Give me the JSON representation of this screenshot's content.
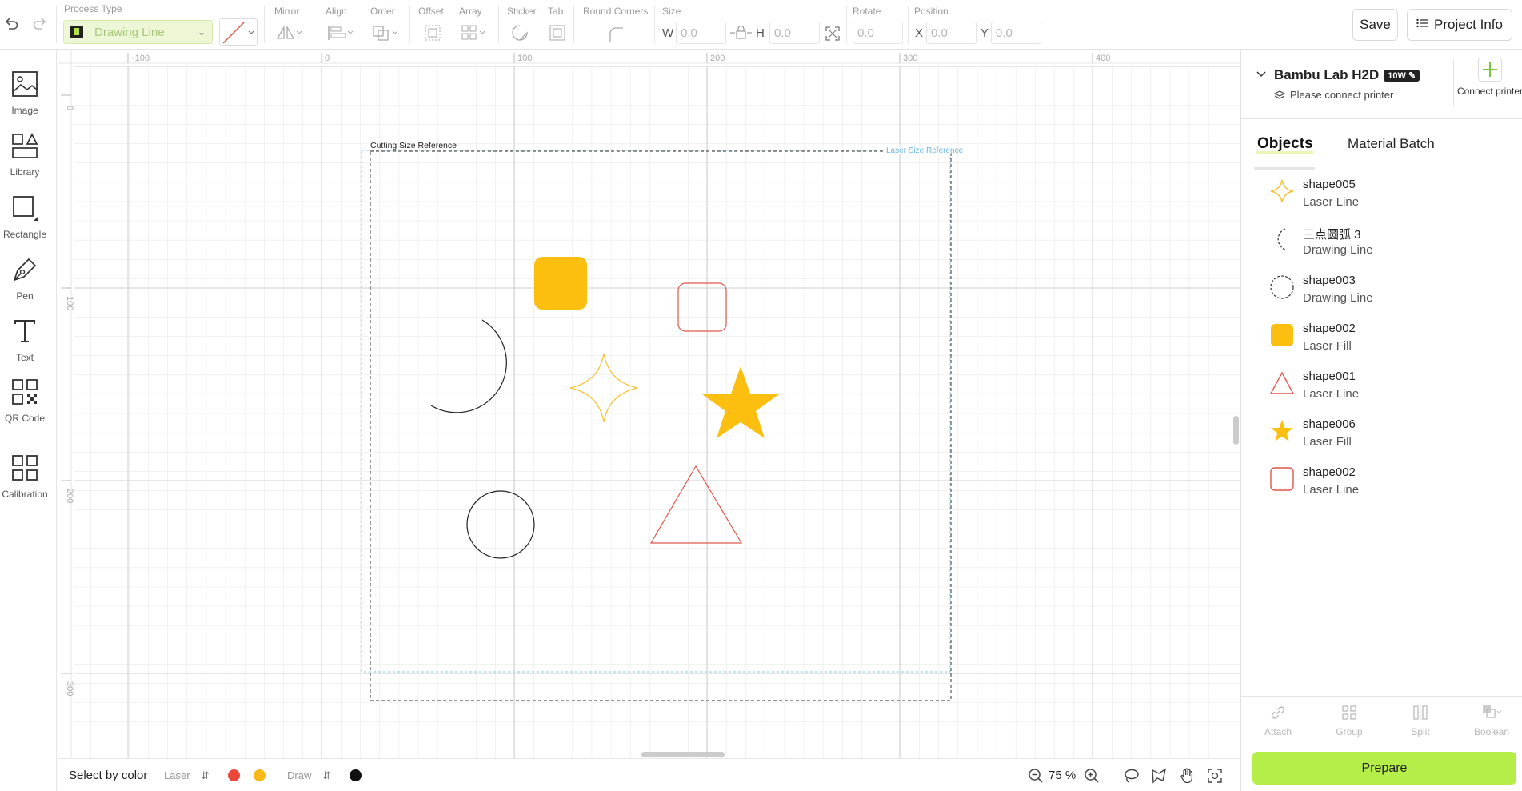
{
  "toolbar": {
    "process_type_label": "Process Type",
    "process_type_value": "Drawing Line",
    "mirror_label": "Mirror",
    "align_label": "Align",
    "order_label": "Order",
    "offset_label": "Offset",
    "array_label": "Array",
    "sticker_label": "Sticker",
    "tab_label": "Tab",
    "round_corners_label": "Round Corners",
    "size_label": "Size",
    "w_label": "W",
    "w_value": "0.0",
    "h_label": "H",
    "h_value": "0.0",
    "rotate_label": "Rotate",
    "rotate_value": "0.0",
    "position_label": "Position",
    "x_label": "X",
    "x_value": "0.0",
    "y_label": "Y",
    "y_value": "0.0",
    "save_label": "Save",
    "project_info_label": "Project Info"
  },
  "leftbar": {
    "items": [
      {
        "label": "Image",
        "icon": "image-icon"
      },
      {
        "label": "Library",
        "icon": "library-icon"
      },
      {
        "label": "Rectangle",
        "icon": "rectangle-icon"
      },
      {
        "label": "Pen",
        "icon": "pen-icon"
      },
      {
        "label": "Text",
        "icon": "text-icon"
      },
      {
        "label": "QR Code",
        "icon": "qr-code-icon"
      },
      {
        "label": "Calibration",
        "icon": "calibration-icon"
      }
    ]
  },
  "canvas": {
    "ruler_top": [
      "-100",
      "0",
      "100",
      "200",
      "300",
      "400"
    ],
    "ruler_left": [
      "0",
      "100",
      "200",
      "300"
    ],
    "cutting_ref_label": "Cutting Size Reference",
    "laser_ref_label": "Laser Size Reference"
  },
  "bottombar": {
    "select_by_color": "Select by color",
    "laser_label": "Laser",
    "draw_label": "Draw",
    "zoom_value": "75 %",
    "laser_colors": [
      "#e8473a",
      "#f6b918"
    ],
    "draw_colors": [
      "#111111"
    ]
  },
  "rightpanel": {
    "printer_name": "Bambu Lab H2D",
    "printer_badge": "10W",
    "printer_status": "Please connect printer",
    "connect_label": "Connect printer",
    "tabs": [
      "Objects",
      "Material Batch"
    ],
    "objects": [
      {
        "name": "shape005",
        "type": "Laser Line",
        "icon": "four-point-star-icon"
      },
      {
        "name": "三点圆弧 3",
        "type": "Drawing Line",
        "icon": "arc-icon"
      },
      {
        "name": "shape003",
        "type": "Drawing Line",
        "icon": "circle-icon"
      },
      {
        "name": "shape002",
        "type": "Laser Fill",
        "icon": "filled-square-icon"
      },
      {
        "name": "shape001",
        "type": "Laser Line",
        "icon": "triangle-icon"
      },
      {
        "name": "shape006",
        "type": "Laser Fill",
        "icon": "filled-star-icon"
      },
      {
        "name": "shape002",
        "type": "Laser Line",
        "icon": "rounded-square-icon"
      }
    ],
    "actions": [
      "Attach",
      "Group",
      "Split",
      "Boolean"
    ],
    "prepare_label": "Prepare"
  },
  "colors": {
    "accent": "#b5ee48",
    "yellow": "#fdbf0f",
    "red_line": "#e0574a"
  }
}
